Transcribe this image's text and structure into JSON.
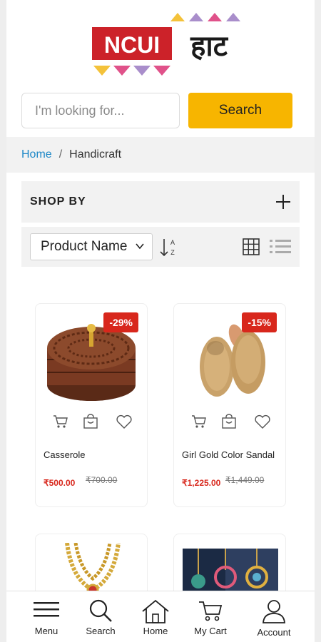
{
  "header": {
    "logo_latin": "NCUI",
    "logo_devanagari": "हाट",
    "colors": {
      "logo_red": "#cc2229",
      "tri_yellow": "#f4c23a",
      "tri_pink": "#e0528a",
      "tri_purple": "#a98ecb",
      "tri_green": "#8fc26a"
    }
  },
  "search": {
    "placeholder": "I'm looking for...",
    "button_label": "Search"
  },
  "breadcrumb": {
    "home": "Home",
    "separator": "/",
    "current": "Handicraft"
  },
  "filters": {
    "shop_by_label": "SHOP BY",
    "sort_selected": "Product Name"
  },
  "products": [
    {
      "name": "Casserole",
      "discount": "-29%",
      "price": "₹500.00",
      "old_price": "₹700.00"
    },
    {
      "name": "Girl Gold Color Sandal",
      "discount": "-15%",
      "price": "₹1,225.00",
      "old_price": "₹1,449.00"
    }
  ],
  "nav": {
    "menu": "Menu",
    "search": "Search",
    "home": "Home",
    "cart": "My Cart",
    "account": "Account"
  },
  "colors": {
    "accent": "#f7b500",
    "sale": "#d8271c",
    "link": "#1e88c7"
  }
}
